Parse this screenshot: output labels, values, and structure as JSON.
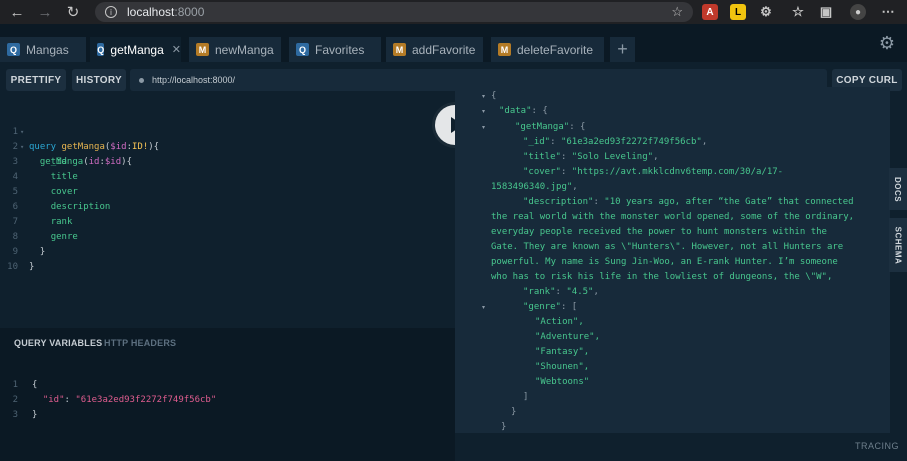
{
  "browser": {
    "host": "localhost",
    "port": ":8000"
  },
  "tabs": [
    {
      "badge": "Q",
      "label": "Mangas"
    },
    {
      "badge": "Q",
      "label": "getManga",
      "close": "✕"
    },
    {
      "badge": "M",
      "label": "newManga"
    },
    {
      "badge": "Q",
      "label": "Favorites"
    },
    {
      "badge": "M",
      "label": "addFavorite"
    },
    {
      "badge": "M",
      "label": "deleteFavorite"
    }
  ],
  "tab_add": "+",
  "toolbar": {
    "prettify": "PRETTIFY",
    "history": "HISTORY",
    "endpoint": "http://localhost:8000/",
    "copy_curl": "COPY CURL"
  },
  "query_lines": [
    "1",
    "2",
    "3",
    "4",
    "5",
    "6",
    "7",
    "8",
    "9",
    "10"
  ],
  "query": {
    "kw": "query",
    "op": "getManga",
    "var": "$id",
    "type": "ID!",
    "field": "getManga",
    "arg": "id",
    "fields": [
      "_id",
      "title",
      "cover",
      "description",
      "rank",
      "genre"
    ]
  },
  "variables": {
    "tab_vars": "QUERY VARIABLES",
    "tab_headers": "HTTP HEADERS",
    "key": "\"id\"",
    "value": "\"61e3a2ed93f2272f749f56cb\""
  },
  "result": {
    "data_key": "\"data\"",
    "getManga_key": "\"getManga\"",
    "id_key": "\"_id\"",
    "id_val": "\"61e3a2ed93f2272f749f56cb\"",
    "title_key": "\"title\"",
    "title_val": "\"Solo Leveling\"",
    "cover_key": "\"cover\"",
    "cover_val_1": "\"https://avt.mkklcdnv6temp.com/30/a/17-",
    "cover_val_2": "1583496340.jpg\"",
    "desc_key": "\"description\"",
    "desc_val": [
      "\"10 years ago, after “the Gate” that connected",
      "the real world with the monster world opened, some of the ordinary,",
      "everyday people received the power to hunt monsters within the",
      "Gate. They are known as \\\"Hunters\\\". However, not all Hunters are",
      "powerful. My name is Sung Jin-Woo, an E-rank Hunter. I’m someone",
      "who has to risk his life in the lowliest of dungeons, the \\\"W\","
    ],
    "rank_key": "\"rank\"",
    "rank_val": "\"4.5\"",
    "genre_key": "\"genre\"",
    "genres": [
      "\"Action\",",
      "\"Adventure\",",
      "\"Fantasy\",",
      "\"Shounen\",",
      "\"Webtoons\""
    ]
  },
  "side_tabs": {
    "docs": "DOCS",
    "schema": "SCHEMA"
  },
  "tracing": "TRACING"
}
